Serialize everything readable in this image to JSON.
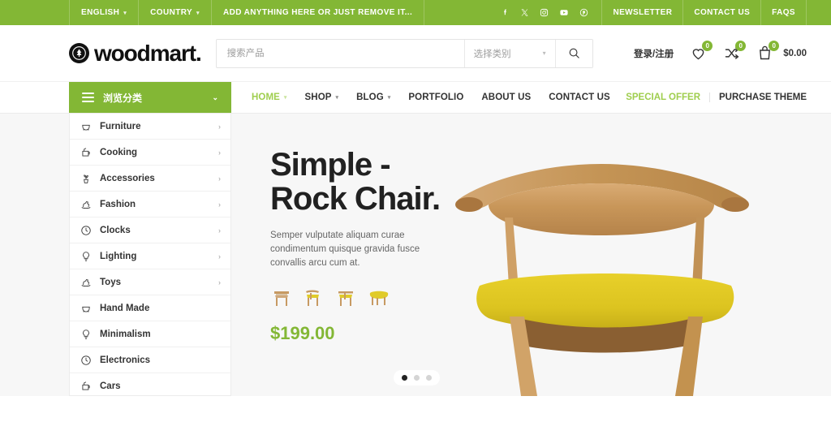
{
  "topbar": {
    "left_items": [
      {
        "label": "ENGLISH",
        "caret": true
      },
      {
        "label": "COUNTRY",
        "caret": true
      },
      {
        "label": "ADD ANYTHING HERE OR JUST REMOVE IT...",
        "caret": false
      }
    ],
    "social": [
      "facebook-icon",
      "x-twitter-icon",
      "instagram-icon",
      "youtube-icon",
      "pinterest-icon"
    ],
    "links": [
      "NEWSLETTER",
      "CONTACT US",
      "FAQS"
    ],
    "bg_color": "#83b735"
  },
  "header": {
    "logo_text": "woodmart.",
    "logo_mark": "tree-in-circle-icon",
    "search": {
      "placeholder": "搜索产品",
      "value": "",
      "category_selected": "选择类别"
    },
    "account_label": "登录/注册",
    "wishlist_count": "0",
    "compare_count": "0",
    "cart_count": "0",
    "cart_total": "$0.00"
  },
  "nav": {
    "categories_toggle": "浏览分类",
    "items": [
      {
        "label": "HOME",
        "caret": true,
        "active": true
      },
      {
        "label": "SHOP",
        "caret": true,
        "active": false
      },
      {
        "label": "BLOG",
        "caret": true,
        "active": false
      },
      {
        "label": "PORTFOLIO",
        "caret": false,
        "active": false
      },
      {
        "label": "ABOUT US",
        "caret": false,
        "active": false
      },
      {
        "label": "CONTACT US",
        "caret": false,
        "active": false
      }
    ],
    "special_offer": "SPECIAL OFFER",
    "purchase_theme": "PURCHASE THEME",
    "accent_color": "#9fce4e"
  },
  "sidebar": {
    "items": [
      {
        "label": "Furniture",
        "icon": "armchair-icon",
        "arrow": true
      },
      {
        "label": "Cooking",
        "icon": "cooking-pot-icon",
        "arrow": true
      },
      {
        "label": "Accessories",
        "icon": "plant-icon",
        "arrow": true
      },
      {
        "label": "Fashion",
        "icon": "rocking-horse-icon",
        "arrow": true
      },
      {
        "label": "Clocks",
        "icon": "clock-icon",
        "arrow": true
      },
      {
        "label": "Lighting",
        "icon": "bulb-icon",
        "arrow": true
      },
      {
        "label": "Toys",
        "icon": "rocking-horse-icon",
        "arrow": true
      },
      {
        "label": "Hand Made",
        "icon": "armchair-icon",
        "arrow": false
      },
      {
        "label": "Minimalism",
        "icon": "bulb-icon",
        "arrow": false
      },
      {
        "label": "Electronics",
        "icon": "clock-icon",
        "arrow": false
      },
      {
        "label": "Cars",
        "icon": "cooking-pot-icon",
        "arrow": false
      }
    ]
  },
  "hero": {
    "title": "Simple -\nRock Chair.",
    "subtitle": "Semper vulputate aliquam curae condimentum quisque gravida fusce convallis arcu cum at.",
    "price": "$199.00",
    "price_color": "#83b735",
    "thumbnails": [
      "chair-thumb-1",
      "chair-thumb-2",
      "chair-thumb-3",
      "chair-thumb-4"
    ],
    "slide_dots": 3,
    "active_dot": 1,
    "product_image": "wooden-chair-yellow-seat"
  }
}
